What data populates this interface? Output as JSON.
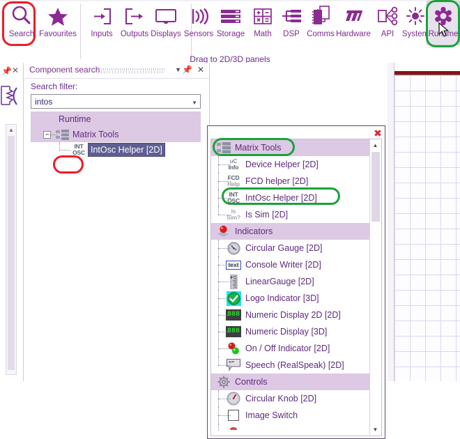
{
  "ribbon": {
    "items": [
      {
        "label": "Search",
        "icon": "magnifier-icon"
      },
      {
        "label": "Favourites",
        "icon": "star-icon"
      },
      {
        "label": "Inputs",
        "icon": "arrow-into-box-icon"
      },
      {
        "label": "Outputs",
        "icon": "arrow-out-of-box-icon"
      },
      {
        "label": "Displays",
        "icon": "monitor-icon"
      },
      {
        "label": "Sensors",
        "icon": "signal-waves-icon"
      },
      {
        "label": "Storage",
        "icon": "server-stack-icon"
      },
      {
        "label": "Math",
        "icon": "calculator-grid-icon"
      },
      {
        "label": "DSP",
        "icon": "filter-bars-icon"
      },
      {
        "label": "Comms",
        "icon": "chip-connector-icon"
      },
      {
        "label": "Hardware",
        "icon": "matrix-logo-icon"
      },
      {
        "label": "API",
        "icon": "node-tree-icon"
      },
      {
        "label": "System",
        "icon": "sun-icon"
      },
      {
        "label": "Runtime",
        "icon": "gear-asterisk-icon"
      }
    ],
    "selected_label": "Runtime",
    "drag_hint": "Drag to 2D/3D panels",
    "annotation_red_target": "Search",
    "annotation_green_target": "Runtime",
    "accent_color": "#7b2d8e",
    "annotation_red_color": "#ee1c25",
    "annotation_green_color": "#1aa13c"
  },
  "left_strip": {
    "pin_icon": "pin-icon",
    "close_icon": "close-icon",
    "decoration_icon": "circuit-symbol-icon",
    "scrollbar_up_icon": "scroll-up-arrow-icon"
  },
  "component_search": {
    "title": "Component search",
    "grip_icon": "drag-grip-icon",
    "dropdown_icon": "chevron-down-icon",
    "pin_icon": "pin-icon",
    "close_icon": "close-icon",
    "filter_label": "Search filter:",
    "filter_value": "intos",
    "filter_placeholder": "",
    "combo_arrow_icon": "chevron-down-icon",
    "tree": [
      {
        "label": "Runtime",
        "depth": 0,
        "highlight": true,
        "selected": false,
        "icon": "",
        "expander": ""
      },
      {
        "label": "Matrix Tools",
        "depth": 1,
        "highlight": true,
        "selected": false,
        "icon": "matrix-tools-icon",
        "expander": "minus"
      },
      {
        "label": "IntOsc Helper [2D]",
        "depth": 2,
        "highlight": false,
        "selected": true,
        "icon": "intosc-badge-icon",
        "expander": ""
      }
    ]
  },
  "dialog": {
    "close_icon": "close-icon",
    "scroll_up_icon": "scroll-up-arrow-icon",
    "scroll_down_icon": "scroll-down-arrow-icon",
    "rows": [
      {
        "type": "group",
        "label": "Matrix Tools",
        "icon": "matrix-tools-icon",
        "annotated": "green"
      },
      {
        "type": "item",
        "label": "Device Helper [2D]",
        "icon": "uc-info-badge-icon",
        "annotated": ""
      },
      {
        "type": "item",
        "label": "FCD helper [2D]",
        "icon": "fcd-help-badge-icon",
        "annotated": ""
      },
      {
        "type": "item",
        "label": "IntOsc Helper [2D]",
        "icon": "intosc-badge-icon",
        "annotated": "green"
      },
      {
        "type": "item",
        "label": "Is Sim [2D]",
        "icon": "is-sim-badge-icon",
        "annotated": ""
      },
      {
        "type": "group",
        "label": "Indicators",
        "icon": "red-lamp-icon",
        "annotated": ""
      },
      {
        "type": "item",
        "label": "Circular Gauge [2D]",
        "icon": "circular-gauge-icon",
        "annotated": ""
      },
      {
        "type": "item",
        "label": "Console Writer [2D]",
        "icon": "text-box-icon",
        "annotated": ""
      },
      {
        "type": "item",
        "label": "LinearGauge [2D]",
        "icon": "linear-gauge-icon",
        "annotated": ""
      },
      {
        "type": "item",
        "label": "Logo Indicator [3D]",
        "icon": "green-check-icon",
        "annotated": ""
      },
      {
        "type": "item",
        "label": "Numeric Display 2D [2D]",
        "icon": "seven-segment-icon",
        "annotated": ""
      },
      {
        "type": "item",
        "label": "Numeric Display [3D]",
        "icon": "seven-segment-icon",
        "annotated": ""
      },
      {
        "type": "item",
        "label": "On / Off Indicator [2D]",
        "icon": "two-lamps-icon",
        "annotated": ""
      },
      {
        "type": "item",
        "label": "Speech (RealSpeak) [2D]",
        "icon": "speech-bubble-icon",
        "annotated": ""
      },
      {
        "type": "group",
        "label": "Controls",
        "icon": "gear-outline-icon",
        "annotated": ""
      },
      {
        "type": "item",
        "label": "Circular Knob [2D]",
        "icon": "circular-knob-icon",
        "annotated": ""
      },
      {
        "type": "item",
        "label": "Image Switch",
        "icon": "empty-square-icon",
        "annotated": ""
      }
    ]
  },
  "canvas": {
    "grid_visible": true,
    "ruler_bar_color": "#8c1015"
  }
}
